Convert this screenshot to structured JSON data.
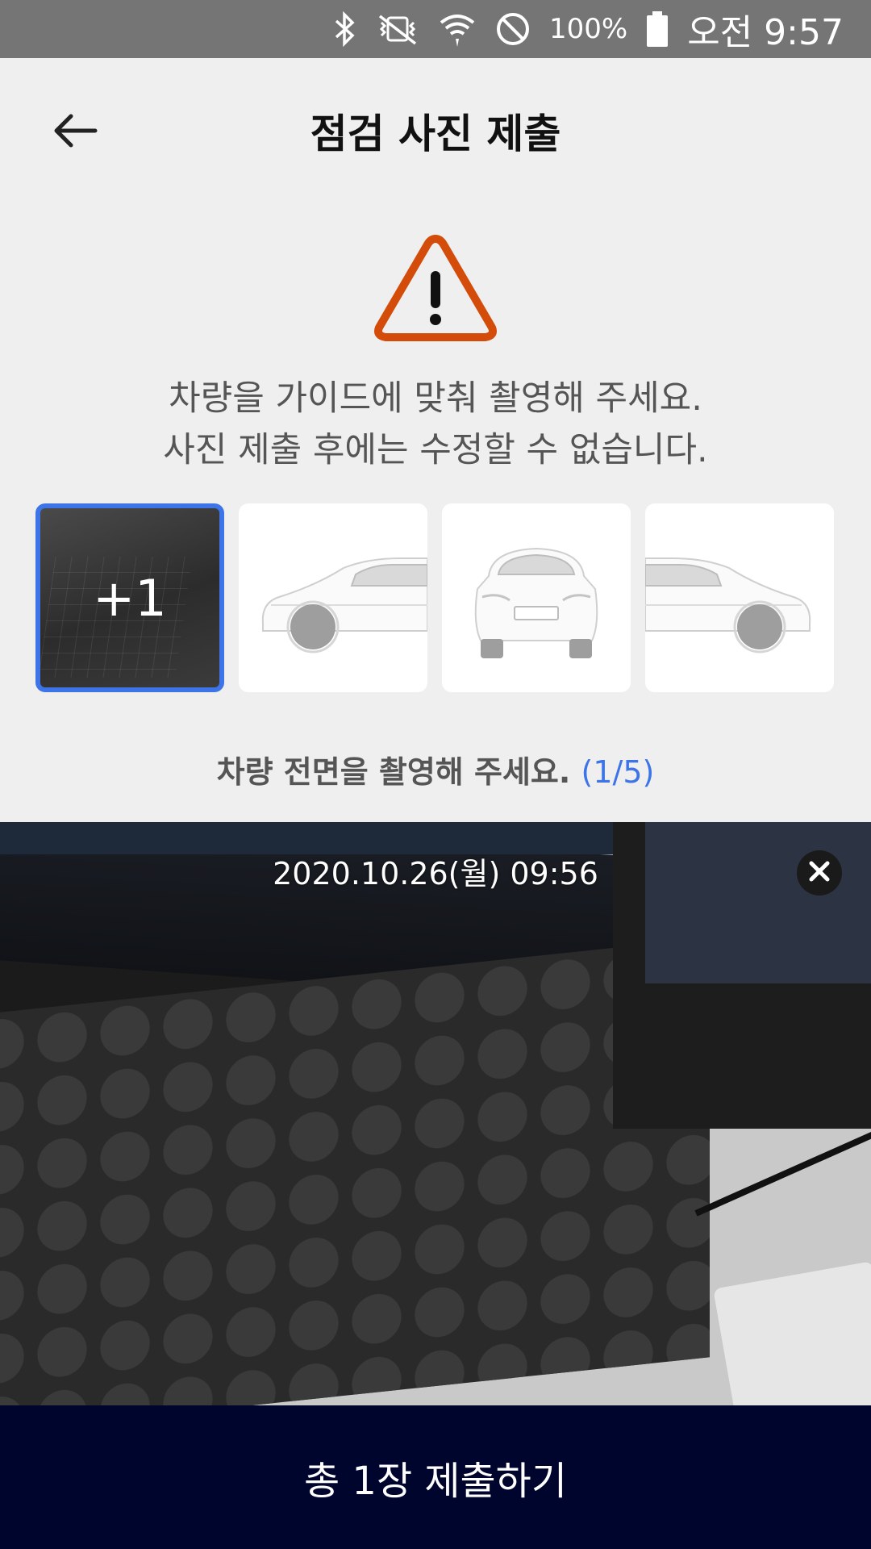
{
  "status_bar": {
    "battery": "100%",
    "time": "오전 9:57",
    "icons": [
      "bluetooth-icon",
      "vibrate-off-icon",
      "wifi-icon",
      "do-not-disturb-icon",
      "battery-icon"
    ]
  },
  "header": {
    "title": "점검 사진 제출",
    "back_icon": "arrow-left-icon"
  },
  "warning": {
    "icon": "warning-triangle-icon",
    "color": "#d34c09",
    "line1": "차량을 가이드에 맞춰 촬영해 주세요.",
    "line2": "사진 제출 후에는 수정할 수 없습니다."
  },
  "thumbnails": [
    {
      "kind": "captured-photo",
      "overlay": "+1",
      "selected": true
    },
    {
      "kind": "car-side-left-guide",
      "selected": false
    },
    {
      "kind": "car-rear-guide",
      "selected": false
    },
    {
      "kind": "car-side-right-guide",
      "selected": false
    }
  ],
  "instruction": {
    "text": "차량 전면을 촬영해 주세요.",
    "counter": "(1/5)"
  },
  "preview": {
    "timestamp": "2020.10.26(월) 09:56",
    "close_icon": "close-icon"
  },
  "submit": {
    "label": "총 1장 제출하기",
    "background": "#00052d"
  },
  "colors": {
    "accent": "#3d74e8",
    "background": "#efefef",
    "status_bar": "#757575"
  }
}
